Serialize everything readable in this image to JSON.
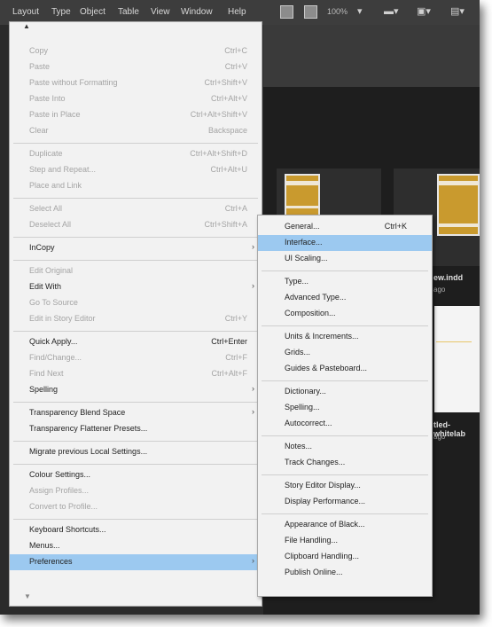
{
  "menubar": {
    "items": [
      "Layout",
      "Type",
      "Object",
      "Table",
      "View",
      "Window",
      "Help"
    ],
    "zoom": "100%"
  },
  "edit_menu": {
    "items": [
      {
        "label": "Copy",
        "shortcut": "Ctrl+C",
        "disabled": true
      },
      {
        "label": "Paste",
        "shortcut": "Ctrl+V",
        "disabled": true
      },
      {
        "label": "Paste without Formatting",
        "shortcut": "Ctrl+Shift+V",
        "disabled": true
      },
      {
        "label": "Paste Into",
        "shortcut": "Ctrl+Alt+V",
        "disabled": true
      },
      {
        "label": "Paste in Place",
        "shortcut": "Ctrl+Alt+Shift+V",
        "disabled": true
      },
      {
        "label": "Clear",
        "shortcut": "Backspace",
        "disabled": true
      },
      {
        "label": "Duplicate",
        "shortcut": "Ctrl+Alt+Shift+D",
        "disabled": true
      },
      {
        "label": "Step and Repeat...",
        "shortcut": "Ctrl+Alt+U",
        "disabled": true
      },
      {
        "label": "Place and Link",
        "shortcut": "",
        "disabled": true
      },
      {
        "label": "Select All",
        "shortcut": "Ctrl+A",
        "disabled": true
      },
      {
        "label": "Deselect All",
        "shortcut": "Ctrl+Shift+A",
        "disabled": true
      },
      {
        "label": "InCopy",
        "shortcut": "",
        "disabled": false,
        "submenu": true
      },
      {
        "label": "Edit Original",
        "shortcut": "",
        "disabled": true
      },
      {
        "label": "Edit With",
        "shortcut": "",
        "disabled": false,
        "submenu": true
      },
      {
        "label": "Go To Source",
        "shortcut": "",
        "disabled": true
      },
      {
        "label": "Edit in Story Editor",
        "shortcut": "Ctrl+Y",
        "disabled": true
      },
      {
        "label": "Quick Apply...",
        "shortcut": "Ctrl+Enter",
        "disabled": false
      },
      {
        "label": "Find/Change...",
        "shortcut": "Ctrl+F",
        "disabled": true
      },
      {
        "label": "Find Next",
        "shortcut": "Ctrl+Alt+F",
        "disabled": true
      },
      {
        "label": "Spelling",
        "shortcut": "",
        "disabled": false,
        "submenu": true
      },
      {
        "label": "Transparency Blend Space",
        "shortcut": "",
        "disabled": false,
        "submenu": true
      },
      {
        "label": "Transparency Flattener Presets...",
        "shortcut": "",
        "disabled": false
      },
      {
        "label": "Migrate previous Local Settings...",
        "shortcut": "",
        "disabled": false
      },
      {
        "label": "Colour Settings...",
        "shortcut": "",
        "disabled": false
      },
      {
        "label": "Assign Profiles...",
        "shortcut": "",
        "disabled": true
      },
      {
        "label": "Convert to Profile...",
        "shortcut": "",
        "disabled": true
      },
      {
        "label": "Keyboard Shortcuts...",
        "shortcut": "",
        "disabled": false
      },
      {
        "label": "Menus...",
        "shortcut": "",
        "disabled": false
      },
      {
        "label": "Preferences",
        "shortcut": "",
        "disabled": false,
        "submenu": true,
        "highlighted": true
      }
    ]
  },
  "preferences_submenu": {
    "items": [
      {
        "label": "General...",
        "shortcut": "Ctrl+K"
      },
      {
        "label": "Interface...",
        "shortcut": "",
        "highlighted": true
      },
      {
        "label": "UI Scaling...",
        "shortcut": ""
      },
      {
        "label": "Type...",
        "shortcut": ""
      },
      {
        "label": "Advanced Type...",
        "shortcut": ""
      },
      {
        "label": "Composition...",
        "shortcut": ""
      },
      {
        "label": "Units & Increments...",
        "shortcut": ""
      },
      {
        "label": "Grids...",
        "shortcut": ""
      },
      {
        "label": "Guides & Pasteboard...",
        "shortcut": ""
      },
      {
        "label": "Dictionary...",
        "shortcut": ""
      },
      {
        "label": "Spelling...",
        "shortcut": ""
      },
      {
        "label": "Autocorrect...",
        "shortcut": ""
      },
      {
        "label": "Notes...",
        "shortcut": ""
      },
      {
        "label": "Track Changes...",
        "shortcut": ""
      },
      {
        "label": "Story Editor Display...",
        "shortcut": ""
      },
      {
        "label": "Display Performance...",
        "shortcut": ""
      },
      {
        "label": "Appearance of Black...",
        "shortcut": ""
      },
      {
        "label": "File Handling...",
        "shortcut": ""
      },
      {
        "label": "Clipboard Handling...",
        "shortcut": ""
      },
      {
        "label": "Publish Online...",
        "shortcut": ""
      }
    ]
  },
  "workspace": {
    "card_title_1": "ew.indd",
    "card_sub_1": "ago",
    "card_title_2": "tled-whitelab",
    "card_sub_2": "ago"
  }
}
